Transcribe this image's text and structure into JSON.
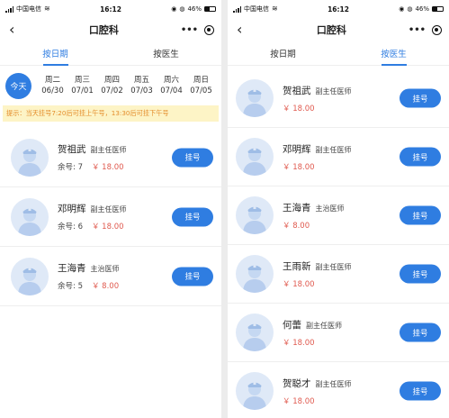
{
  "status": {
    "carrier": "中国电信",
    "time": "16:12",
    "battery": "46%"
  },
  "nav": {
    "back_glyph": "‹",
    "title": "口腔科",
    "more_glyph": "•••"
  },
  "tabs": [
    {
      "label": "按日期"
    },
    {
      "label": "按医生"
    }
  ],
  "left": {
    "active_tab": 0,
    "today_label": "今天",
    "days": [
      {
        "weekday": "周二",
        "date": "06/30"
      },
      {
        "weekday": "周三",
        "date": "07/01"
      },
      {
        "weekday": "周四",
        "date": "07/02"
      },
      {
        "weekday": "周五",
        "date": "07/03"
      },
      {
        "weekday": "周六",
        "date": "07/04"
      },
      {
        "weekday": "周日",
        "date": "07/05"
      }
    ],
    "notice": "提示：当天挂号7:20后可挂上午号，13:30后可挂下午号",
    "doctors": [
      {
        "name": "贺祖武",
        "title": "副主任医师",
        "remain": "余号: 7",
        "price": "￥ 18.00",
        "button": "挂号"
      },
      {
        "name": "邓明辉",
        "title": "副主任医师",
        "remain": "余号: 6",
        "price": "￥ 18.00",
        "button": "挂号"
      },
      {
        "name": "王海青",
        "title": "主治医师",
        "remain": "余号: 5",
        "price": "￥ 8.00",
        "button": "挂号"
      }
    ]
  },
  "right": {
    "active_tab": 1,
    "doctors": [
      {
        "name": "贺祖武",
        "title": "副主任医师",
        "price": "￥ 18.00",
        "button": "挂号"
      },
      {
        "name": "邓明辉",
        "title": "副主任医师",
        "price": "￥ 18.00",
        "button": "挂号"
      },
      {
        "name": "王海青",
        "title": "主治医师",
        "price": "￥ 8.00",
        "button": "挂号"
      },
      {
        "name": "王雨新",
        "title": "副主任医师",
        "price": "￥ 18.00",
        "button": "挂号"
      },
      {
        "name": "何蕾",
        "title": "副主任医师",
        "price": "￥ 18.00",
        "button": "挂号"
      },
      {
        "name": "贺聪才",
        "title": "副主任医师",
        "price": "￥ 18.00",
        "button": "挂号"
      }
    ]
  },
  "colors": {
    "accent": "#2f7de1",
    "price": "#e05a4f",
    "notice_bg": "#fdf4c6",
    "notice_text": "#e48c2a",
    "avatar_bg": "#dfe9f7"
  },
  "icons": {
    "back": "chevron-left-icon",
    "more": "more-dots-icon",
    "close": "target-icon",
    "avatar": "doctor-avatar-icon"
  }
}
